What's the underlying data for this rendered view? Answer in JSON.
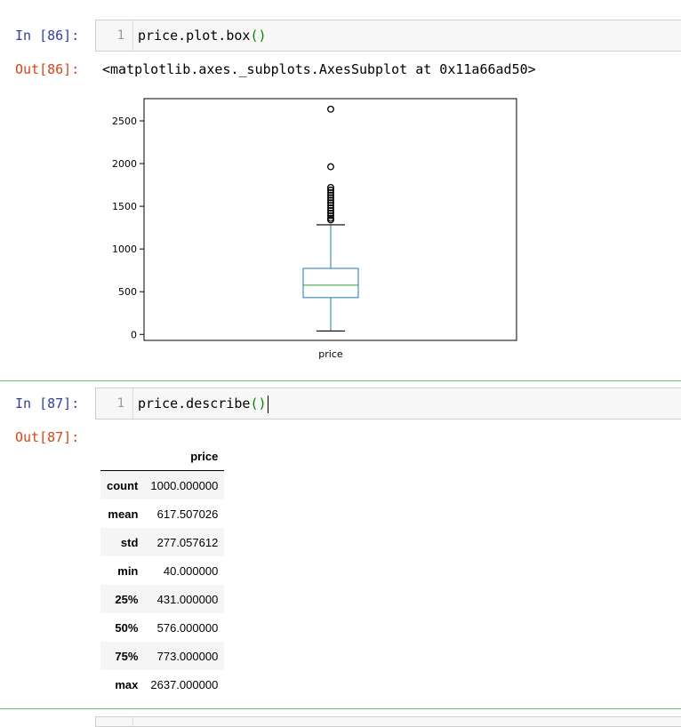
{
  "cell86": {
    "in_prompt": "In [86]:",
    "line_number": "1",
    "code_main": "price.plot.box",
    "code_parens": "()",
    "out_prompt": "Out[86]:",
    "out_text": "<matplotlib.axes._subplots.AxesSubplot at 0x11a66ad50>"
  },
  "chart_data": {
    "type": "box",
    "categories": [
      "price"
    ],
    "xlabel": "",
    "ylabel": "",
    "ylim": [
      -70,
      2760
    ],
    "yticks": [
      0,
      500,
      1000,
      1500,
      2000,
      2500
    ],
    "grid": false,
    "box": {
      "whisker_low": 40,
      "q1": 431,
      "median": 576,
      "q3": 773,
      "whisker_high": 1283
    },
    "outliers": [
      2637,
      1963,
      1720,
      1690,
      1660,
      1630,
      1600,
      1570,
      1540,
      1510,
      1480,
      1450,
      1420,
      1390,
      1360,
      1340
    ],
    "colors": {
      "box": "#1f77b4",
      "median": "#2ca02c",
      "whisker_cap": "#000000",
      "outlier": "#000000"
    }
  },
  "cell87": {
    "in_prompt": "In [87]:",
    "line_number": "1",
    "code_main": "price.describe",
    "code_parens": "()",
    "out_prompt": "Out[87]:",
    "table": {
      "column_header": "price",
      "rows": [
        {
          "label": "count",
          "value": "1000.000000"
        },
        {
          "label": "mean",
          "value": "617.507026"
        },
        {
          "label": "std",
          "value": "277.057612"
        },
        {
          "label": "min",
          "value": "40.000000"
        },
        {
          "label": "25%",
          "value": "431.000000"
        },
        {
          "label": "50%",
          "value": "576.000000"
        },
        {
          "label": "75%",
          "value": "773.000000"
        },
        {
          "label": "max",
          "value": "2637.000000"
        }
      ]
    }
  }
}
